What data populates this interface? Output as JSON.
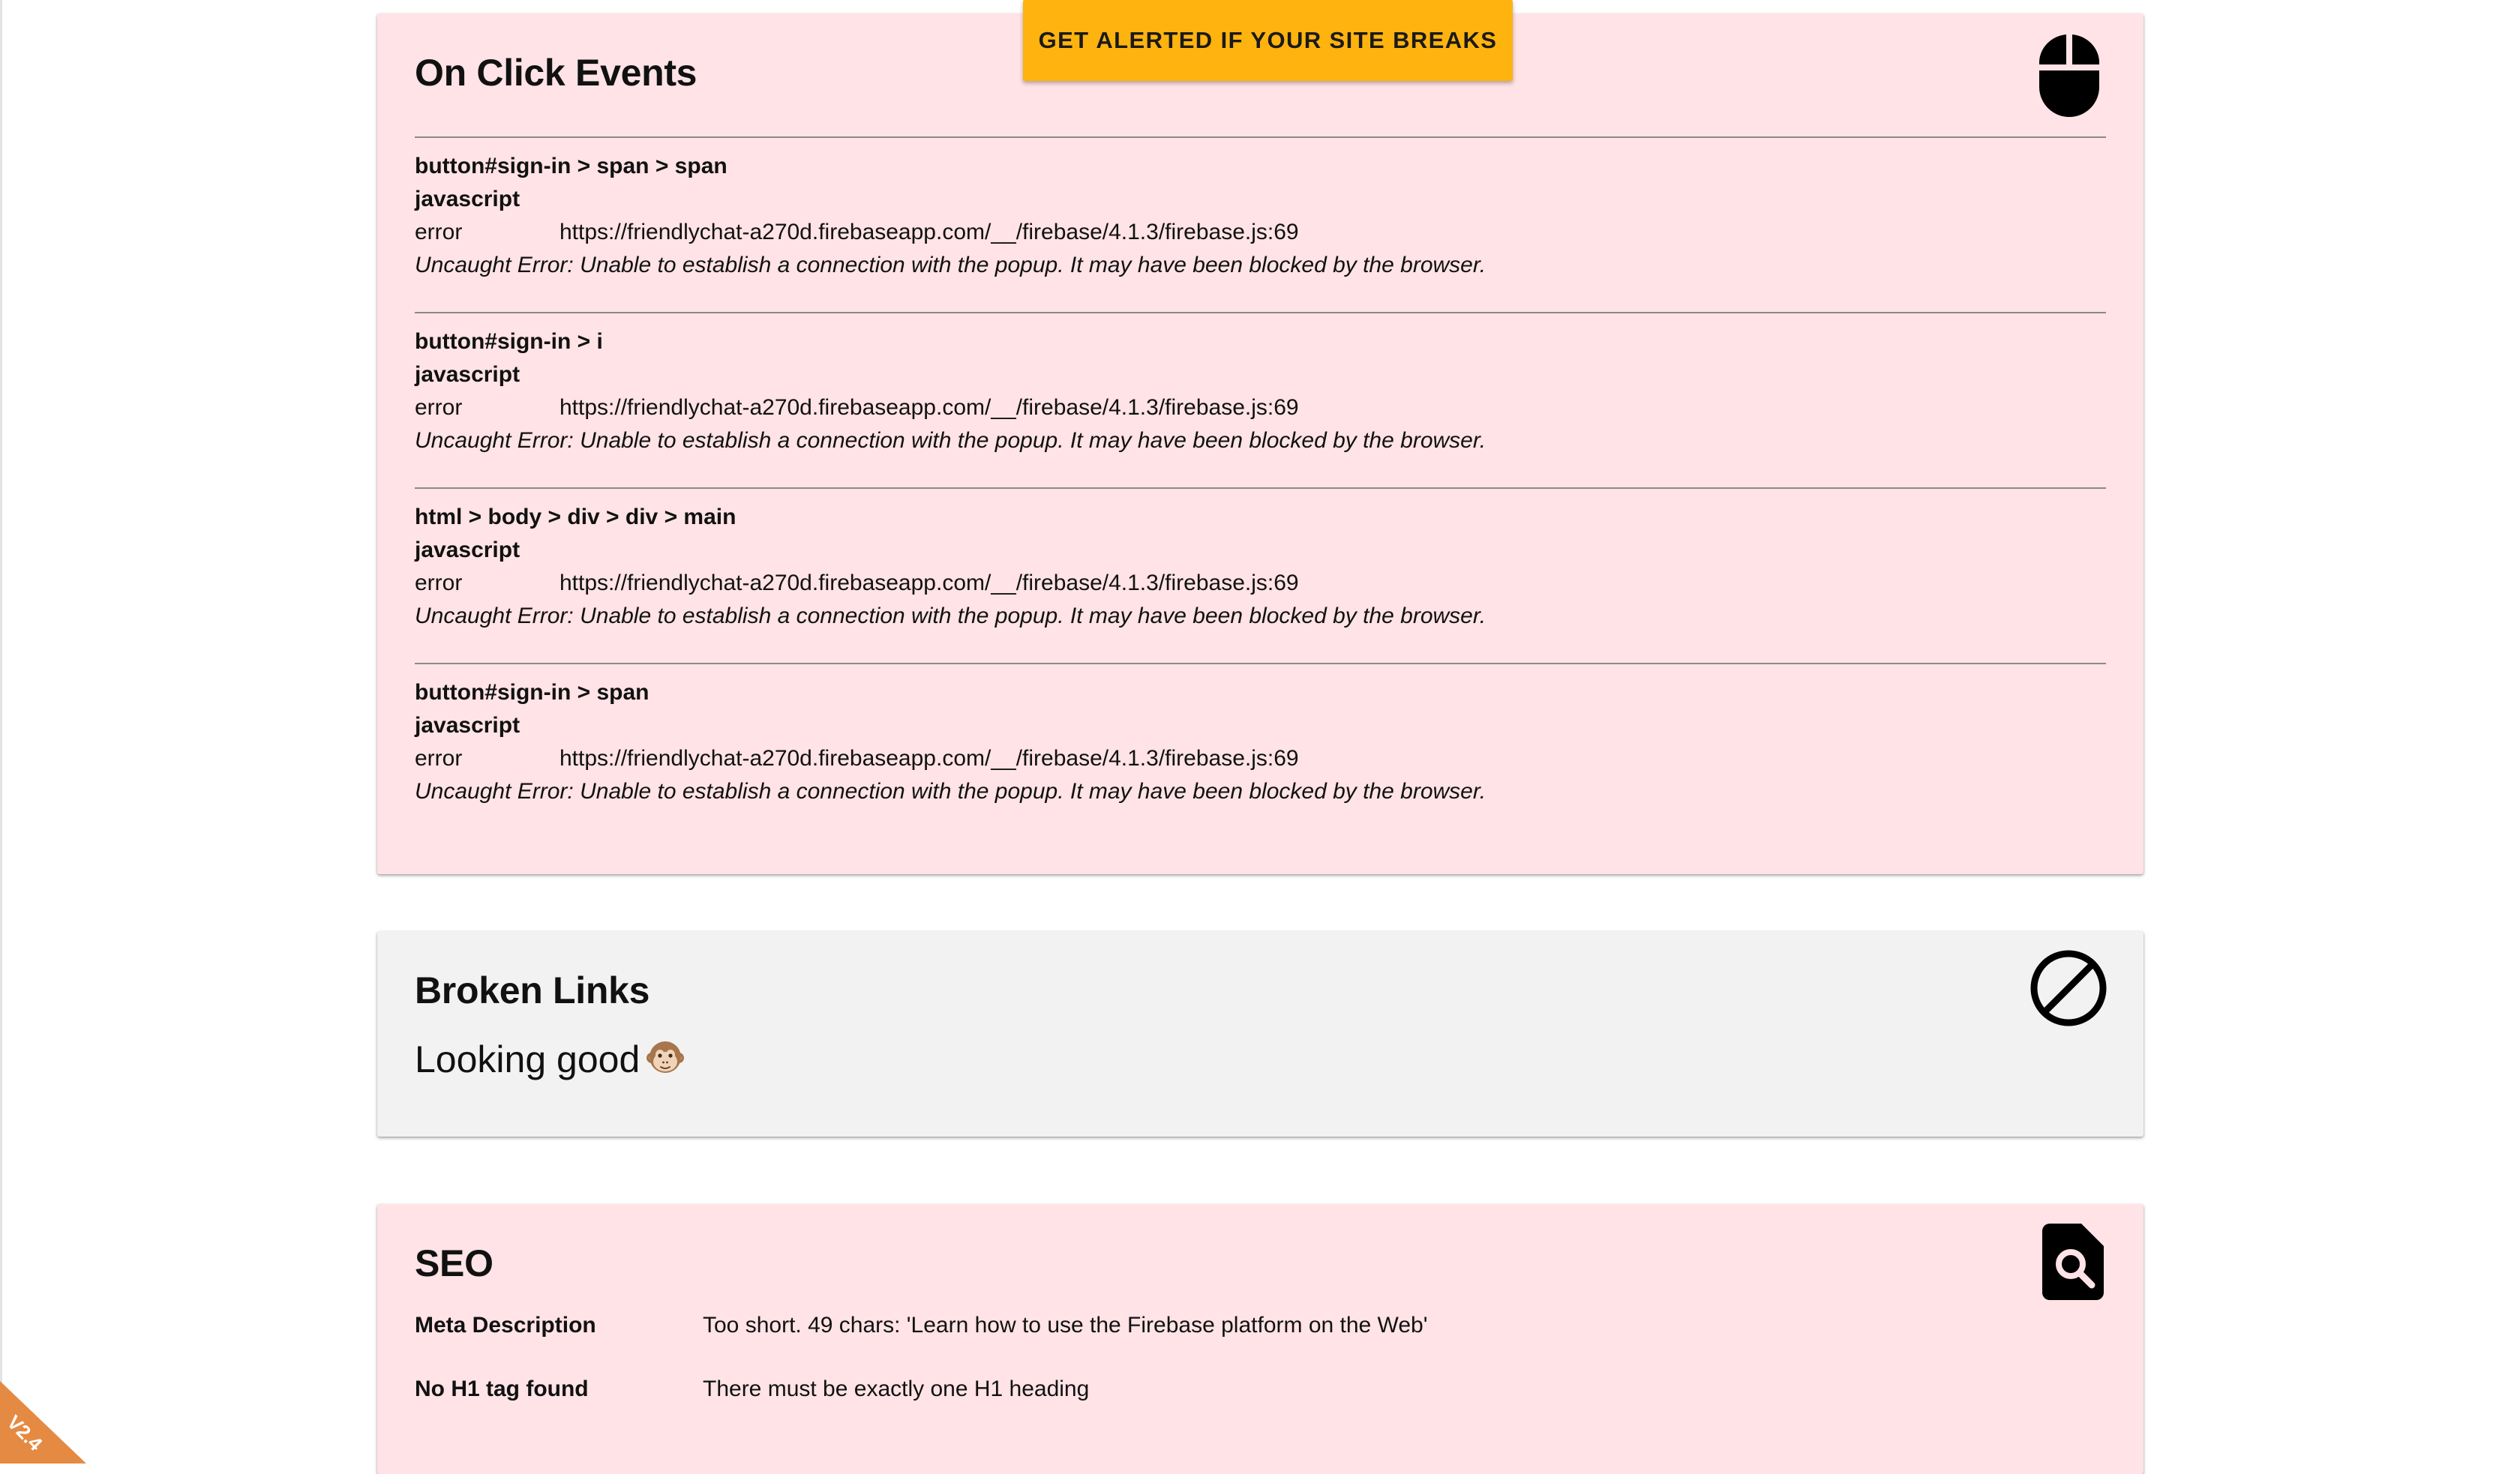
{
  "cta": {
    "label": "GET ALERTED IF YOUR SITE BREAKS"
  },
  "click_events": {
    "title": "On Click Events",
    "icon": "mouse-icon",
    "events": [
      {
        "selector": "button#sign-in > span > span",
        "kind": "javascript",
        "level": "error",
        "source": "https://friendlychat-a270d.firebaseapp.com/__/firebase/4.1.3/firebase.js:69",
        "message": "Uncaught Error: Unable to establish a connection with the popup. It may have been blocked by the browser."
      },
      {
        "selector": "button#sign-in > i",
        "kind": "javascript",
        "level": "error",
        "source": "https://friendlychat-a270d.firebaseapp.com/__/firebase/4.1.3/firebase.js:69",
        "message": "Uncaught Error: Unable to establish a connection with the popup. It may have been blocked by the browser."
      },
      {
        "selector": "html > body > div > div > main",
        "kind": "javascript",
        "level": "error",
        "source": "https://friendlychat-a270d.firebaseapp.com/__/firebase/4.1.3/firebase.js:69",
        "message": "Uncaught Error: Unable to establish a connection with the popup. It may have been blocked by the browser."
      },
      {
        "selector": "button#sign-in > span",
        "kind": "javascript",
        "level": "error",
        "source": "https://friendlychat-a270d.firebaseapp.com/__/firebase/4.1.3/firebase.js:69",
        "message": "Uncaught Error: Unable to establish a connection with the popup. It may have been blocked by the browser."
      }
    ]
  },
  "broken_links": {
    "title": "Broken Links",
    "icon": "block-icon",
    "status": "Looking good",
    "status_icon": "monkey-face-icon"
  },
  "seo": {
    "title": "SEO",
    "icon": "find-in-page-icon",
    "rows": [
      {
        "key": "Meta Description",
        "value": "Too short. 49 chars: 'Learn how to use the Firebase platform on the Web'"
      },
      {
        "key": "No H1 tag found",
        "value": "There must be exactly one H1 heading"
      }
    ]
  },
  "version": {
    "label": "V2.4"
  },
  "colors": {
    "error_card_bg": "#ffe3e6",
    "ok_card_bg": "#f2f2f2",
    "cta_bg": "#ffb30f",
    "ribbon_bg": "#e58a42"
  }
}
